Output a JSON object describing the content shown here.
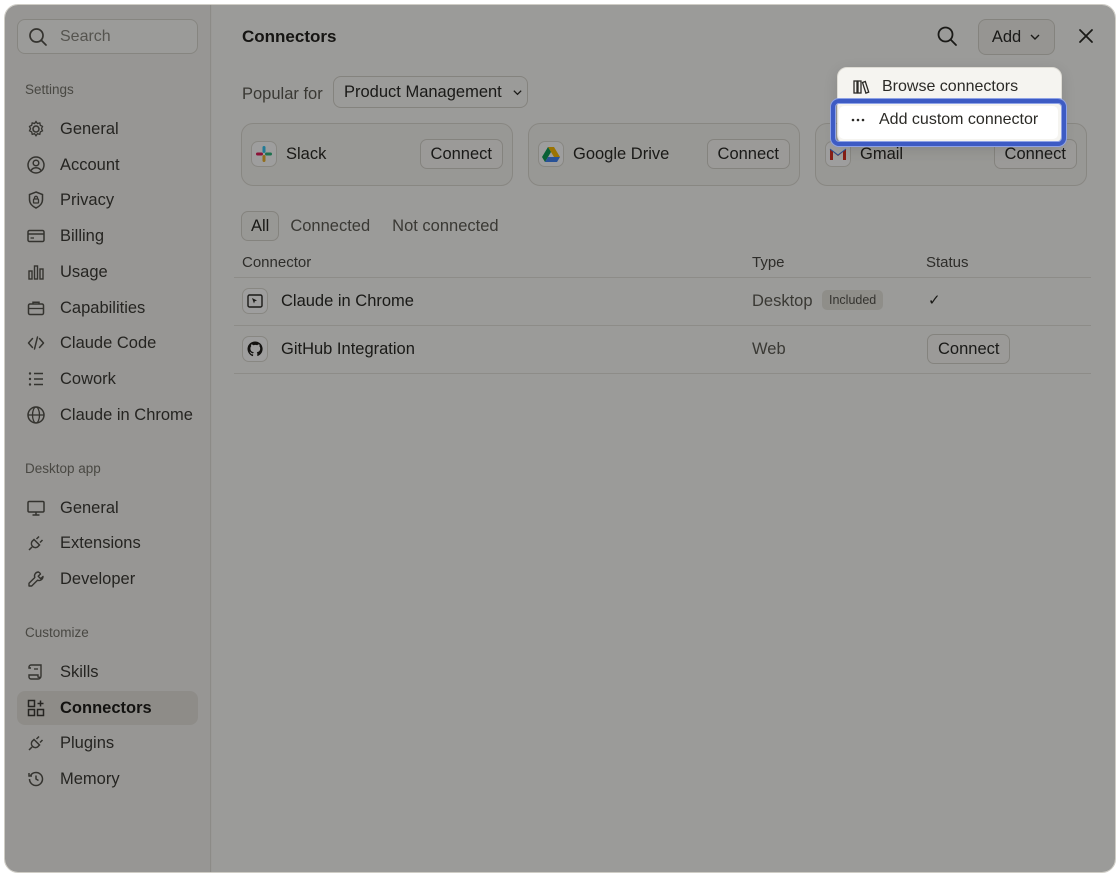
{
  "sidebar": {
    "search_placeholder": "Search",
    "sections": {
      "settings": "Settings",
      "desktop": "Desktop app",
      "customize": "Customize"
    },
    "settings_items": [
      "General",
      "Account",
      "Privacy",
      "Billing",
      "Usage",
      "Capabilities",
      "Claude Code",
      "Cowork",
      "Claude in Chrome"
    ],
    "desktop_items": [
      "General",
      "Extensions",
      "Developer"
    ],
    "customize_items": [
      "Skills",
      "Connectors",
      "Plugins",
      "Memory"
    ],
    "active_item": "Connectors"
  },
  "header": {
    "title": "Connectors",
    "add_label": "Add"
  },
  "popular": {
    "label": "Popular for",
    "selected": "Product Management",
    "cards": [
      {
        "name": "Slack",
        "action": "Connect"
      },
      {
        "name": "Google Drive",
        "action": "Connect"
      },
      {
        "name": "Gmail",
        "action": "Connect"
      }
    ]
  },
  "tabs": [
    "All",
    "Connected",
    "Not connected"
  ],
  "active_tab": "All",
  "table": {
    "headers": [
      "Connector",
      "Type",
      "Status"
    ],
    "rows": [
      {
        "name": "Claude in Chrome",
        "type": "Desktop",
        "badge": "Included",
        "status": "✓"
      },
      {
        "name": "GitHub Integration",
        "type": "Web",
        "action": "Connect"
      }
    ]
  },
  "dropdown": {
    "items": [
      "Browse connectors",
      "Add custom connector"
    ],
    "highlighted": "Add custom connector"
  },
  "colors": {
    "highlight_border": "#3d5bc4",
    "overlay": "rgba(0,0,0,0.38)"
  }
}
